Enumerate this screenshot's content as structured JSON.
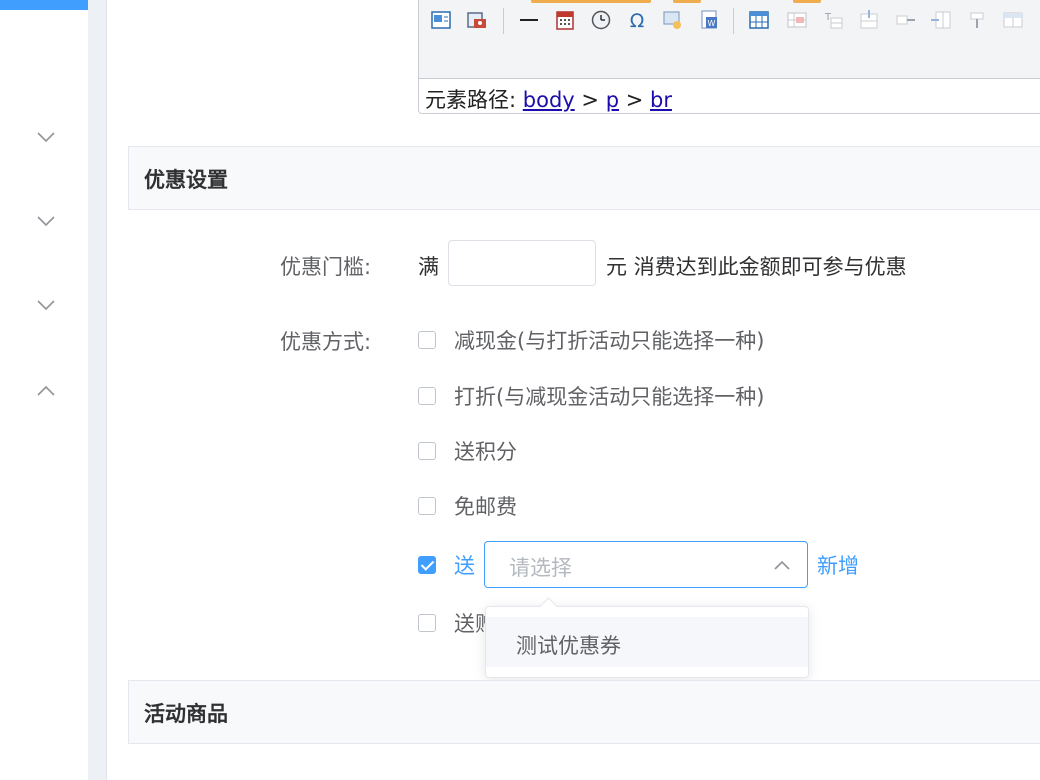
{
  "sidebar": {
    "chevrons": [
      "chevron-down-icon",
      "chevron-down-icon",
      "chevron-down-icon",
      "chevron-up-icon"
    ]
  },
  "editor": {
    "path_label": "元素路径:",
    "path_items": [
      "body",
      "p",
      "br"
    ],
    "path_separator": ">"
  },
  "sections": {
    "discount_settings": "优惠设置",
    "activity_goods": "活动商品"
  },
  "form": {
    "threshold_label": "优惠门槛:",
    "threshold_prefix": "满",
    "threshold_value": "",
    "threshold_suffix": "元 消费达到此金额即可参与优惠",
    "method_label": "优惠方式:",
    "options": [
      {
        "label": "减现金(与打折活动只能选择一种)",
        "checked": false
      },
      {
        "label": "打折(与减现金活动只能选择一种)",
        "checked": false
      },
      {
        "label": "送积分",
        "checked": false
      },
      {
        "label": "免邮费",
        "checked": false
      },
      {
        "label": "送",
        "checked": true
      },
      {
        "label": "送赠",
        "checked": false
      }
    ],
    "coupon_select_placeholder": "请选择",
    "add_new_label": "新增",
    "dropdown_options": [
      "测试优惠券"
    ]
  },
  "colors": {
    "primary": "#409eff",
    "border": "#dcdfe6",
    "text": "#606266",
    "header_bg": "#f8f9fa"
  }
}
